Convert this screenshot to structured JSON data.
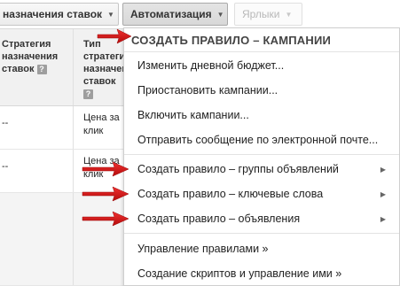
{
  "toolbar": {
    "bid_strategy_button": "назначения ставок",
    "automation_button": "Автоматизация",
    "labels_button": "Ярлыки",
    "caret": "▼"
  },
  "table": {
    "col1_header": "Стратегия назначения ставок",
    "col2_header": "Тип стратегии назначения ставок",
    "help": "?",
    "rows": [
      {
        "col1": "--",
        "col2": "Цена за клик"
      },
      {
        "col1": "--",
        "col2": "Цена за клик"
      }
    ]
  },
  "menu": {
    "header": "СОЗДАТЬ ПРАВИЛО – КАМПАНИИ",
    "items": [
      {
        "label": "Изменить дневной бюджет..."
      },
      {
        "label": "Приостановить кампании..."
      },
      {
        "label": "Включить кампании..."
      },
      {
        "label": "Отправить сообщение по электронной почте..."
      },
      {
        "label": "Создать правило – группы объявлений"
      },
      {
        "label": "Создать правило – ключевые слова"
      },
      {
        "label": "Создать правило – объявления"
      },
      {
        "label": "Управление правилами »"
      },
      {
        "label": "Создание скриптов и управление ими »"
      }
    ],
    "submenu_arrow": "▶"
  },
  "colors": {
    "annotation_arrow": "#d81818",
    "menu_border": "#cfcfcf",
    "active_button": "#dcdcdc"
  }
}
